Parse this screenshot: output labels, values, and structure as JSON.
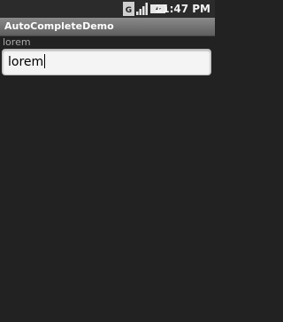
{
  "status_bar": {
    "time": "11:47 PM",
    "icons": [
      "network-3g-icon",
      "signal-strength-icon",
      "battery-icon"
    ]
  },
  "app": {
    "title": "AutoCompleteDemo"
  },
  "selection": {
    "text": "lorem"
  },
  "edit": {
    "value": "lorem"
  },
  "colors": {
    "background": "#222222",
    "status_bar": "#2b2b2b",
    "title_bar_top": "#8a8a8a",
    "title_bar_bottom": "#5e5e5e",
    "field_background": "#f4f4f4"
  }
}
